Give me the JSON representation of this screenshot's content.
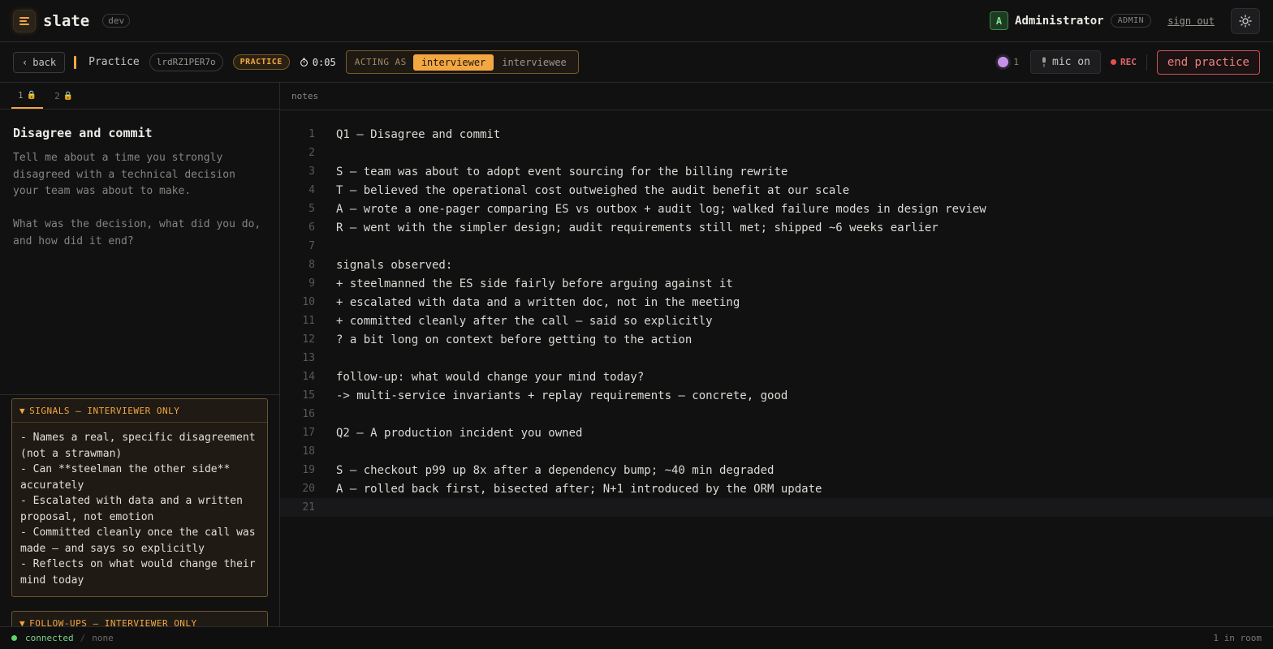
{
  "header": {
    "brand": "slate",
    "env": "dev",
    "user_initial": "A",
    "user_name": "Administrator",
    "user_role": "ADMIN",
    "signout": "sign out",
    "icons": {
      "logo": "menu-lines-icon",
      "theme": "sun-icon"
    },
    "accent_color": "#f3a743"
  },
  "subbar": {
    "back": "back",
    "mode": "Practice",
    "room_code": "lrdRZ1PER7o",
    "badge": "PRACTICE",
    "timer": "0:05",
    "acting_label": "ACTING AS",
    "roles": [
      {
        "label": "interviewer",
        "active": true
      },
      {
        "label": "interviewee",
        "active": false
      }
    ],
    "presence_count": "1",
    "mic": "mic on",
    "rec": "REC",
    "end": "end practice"
  },
  "question_tabs": [
    {
      "label": "1",
      "locked": true,
      "active": true
    },
    {
      "label": "2",
      "locked": true,
      "active": false
    }
  ],
  "question": {
    "title": "Disagree and commit",
    "body": "Tell me about a time you strongly disagreed with a technical decision your team was about to make.\n\nWhat was the decision, what did you do, and how did it end?"
  },
  "signals": {
    "header": "SIGNALS — INTERVIEWER ONLY",
    "body": "- Names a real, specific disagreement (not a strawman)\n- Can **steelman the other side** accurately\n- Escalated with data and a written proposal, not emotion\n- Committed cleanly once the call was made — and says so explicitly\n- Reflects on what would change their mind today"
  },
  "followups": {
    "header": "FOLLOW-UPS — INTERVIEWER ONLY"
  },
  "editor": {
    "label": "notes",
    "current_line": 21,
    "lines": [
      "Q1 — Disagree and commit",
      "",
      "S — team was about to adopt event sourcing for the billing rewrite",
      "T — believed the operational cost outweighed the audit benefit at our scale",
      "A — wrote a one-pager comparing ES vs outbox + audit log; walked failure modes in design review",
      "R — went with the simpler design; audit requirements still met; shipped ~6 weeks earlier",
      "",
      "signals observed:",
      "+ steelmanned the ES side fairly before arguing against it",
      "+ escalated with data and a written doc, not in the meeting",
      "+ committed cleanly after the call — said so explicitly",
      "? a bit long on context before getting to the action",
      "",
      "follow-up: what would change your mind today?",
      "-> multi-service invariants + replay requirements — concrete, good",
      "",
      "Q2 — A production incident you owned",
      "",
      "S — checkout p99 up 8x after a dependency bump; ~40 min degraded",
      "A — rolled back first, bisected after; N+1 introduced by the ORM update",
      ""
    ]
  },
  "status": {
    "connection": "connected",
    "peer": "none",
    "room": "1 in room"
  }
}
